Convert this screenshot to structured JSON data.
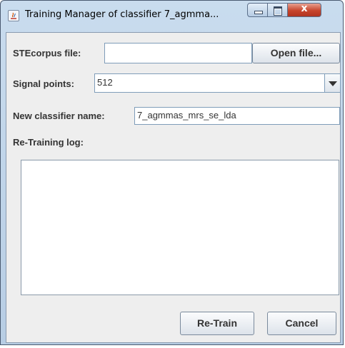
{
  "window": {
    "title": "Training Manager of classifier 7_agmma...",
    "controls": {
      "minimize_icon": "minimize-icon",
      "maximize_icon": "maximize-icon",
      "close_glyph": "x"
    }
  },
  "form": {
    "corpus_label": "STEcorpus file:",
    "corpus_value": "",
    "open_file_button": "Open file...",
    "signal_points_label": "Signal points:",
    "signal_points_value": "512",
    "classifier_name_label": "New classifier name:",
    "classifier_name_value": "7_agmmas_mrs_se_lda",
    "retraining_log_label": "Re-Training log:",
    "retraining_log_text": ""
  },
  "buttons": {
    "retrain": "Re-Train",
    "cancel": "Cancel"
  }
}
